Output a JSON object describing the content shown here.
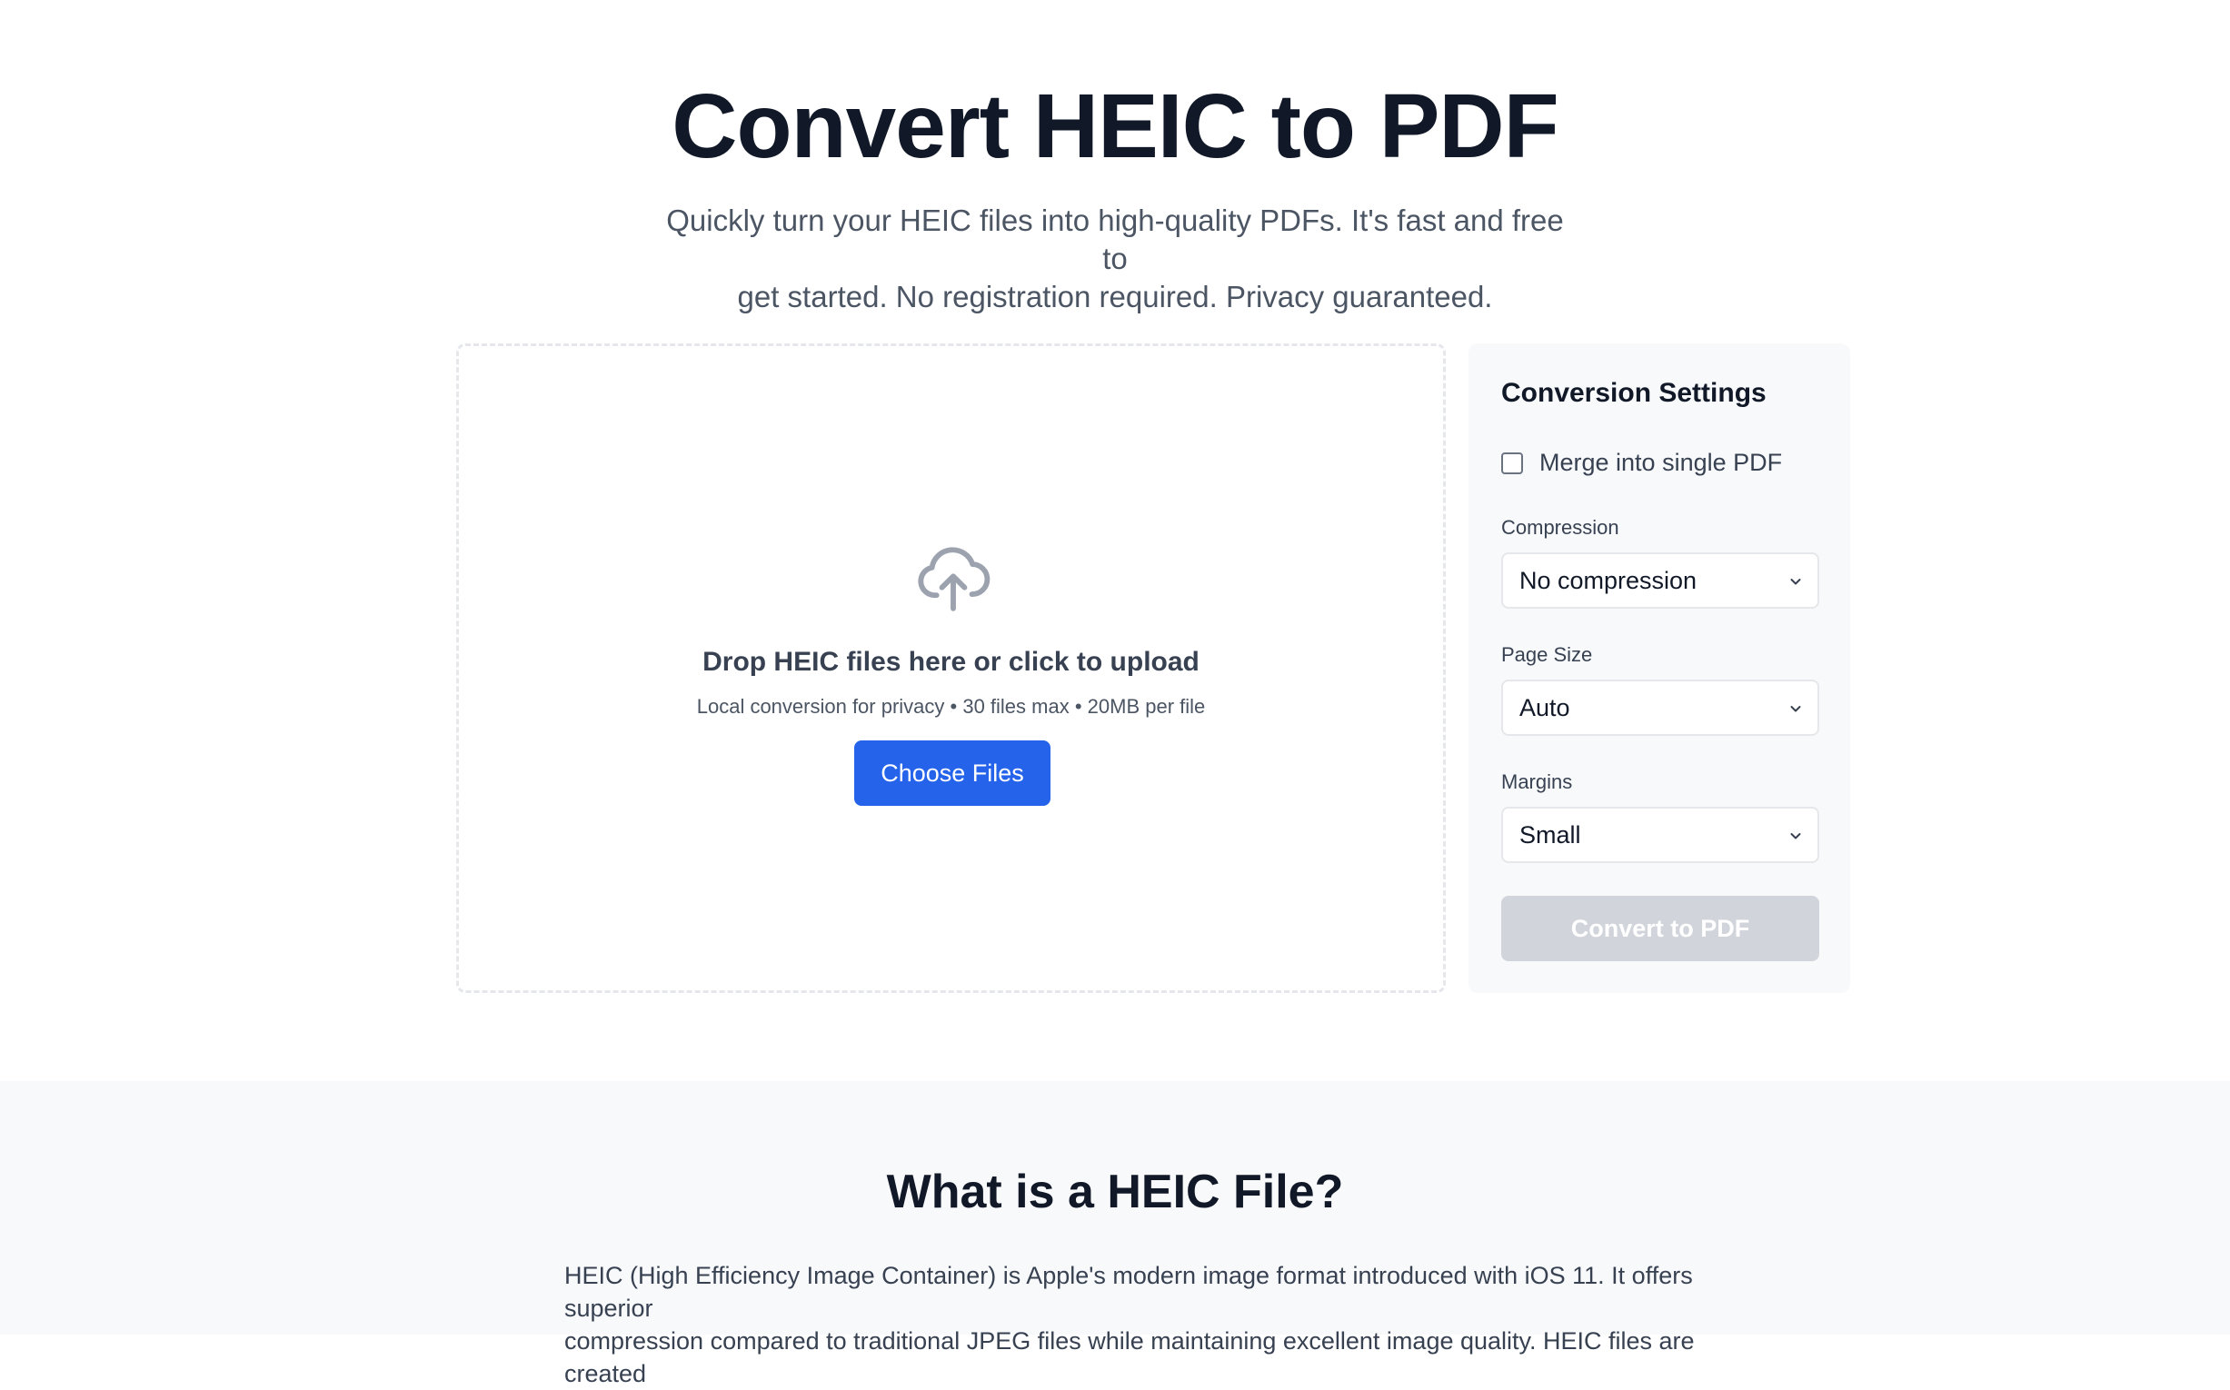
{
  "hero": {
    "title": "Convert HEIC to PDF",
    "subtitle_line1": "Quickly turn your HEIC files into high-quality PDFs. It's fast and free to",
    "subtitle_line2": "get started. No registration required. Privacy guaranteed."
  },
  "upload": {
    "icon": "cloud-upload-icon",
    "title": "Drop HEIC files here or click to upload",
    "note": "Local conversion for privacy • 30 files max • 20MB per file",
    "button_label": "Choose Files"
  },
  "settings": {
    "title": "Conversion Settings",
    "merge_label": "Merge into single PDF",
    "merge_checked": false,
    "compression_label": "Compression",
    "compression_value": "No compression",
    "page_size_label": "Page Size",
    "page_size_value": "Auto",
    "margins_label": "Margins",
    "margins_value": "Small",
    "convert_label": "Convert to PDF"
  },
  "info": {
    "title": "What is a HEIC File?",
    "line1": "HEIC (High Efficiency Image Container) is Apple's modern image format introduced with iOS 11. It offers superior",
    "line2": "compression compared to traditional JPEG files while maintaining excellent image quality. HEIC files are created"
  },
  "colors": {
    "primary": "#2563eb",
    "disabled": "#d1d5db",
    "panel_bg": "#f8f9fb",
    "text_dark": "#111827"
  }
}
